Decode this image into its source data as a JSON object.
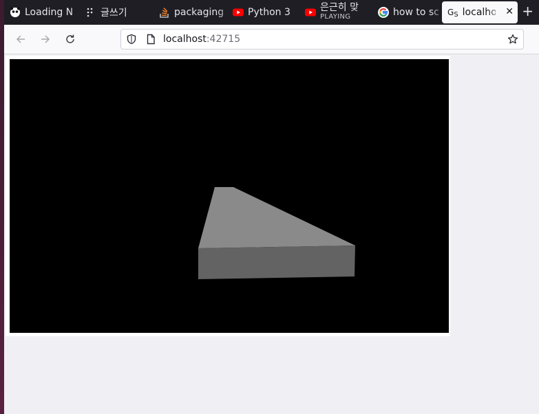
{
  "tabs": [
    {
      "label": "Loading N",
      "icon": "panda-icon"
    },
    {
      "label": "글쓰기",
      "icon": "dots-icon"
    },
    {
      "label": "packaging",
      "icon": "stackoverflow-icon"
    },
    {
      "label": "Python 3",
      "icon": "youtube-icon"
    },
    {
      "label": "은근히 맞",
      "sublabel": "PLAYING",
      "icon": "youtube-icon"
    },
    {
      "label": "how to sc",
      "icon": "google-icon"
    },
    {
      "label": "localhost",
      "icon": "gs-icon",
      "active": true
    }
  ],
  "nav": {
    "url_host": "localhost",
    "url_port": ":42715"
  },
  "colors": {
    "tabbar": "#1f1e25",
    "canvas_bg": "#000000",
    "shape_top": "#8a8a8a",
    "shape_front": "#636363"
  }
}
